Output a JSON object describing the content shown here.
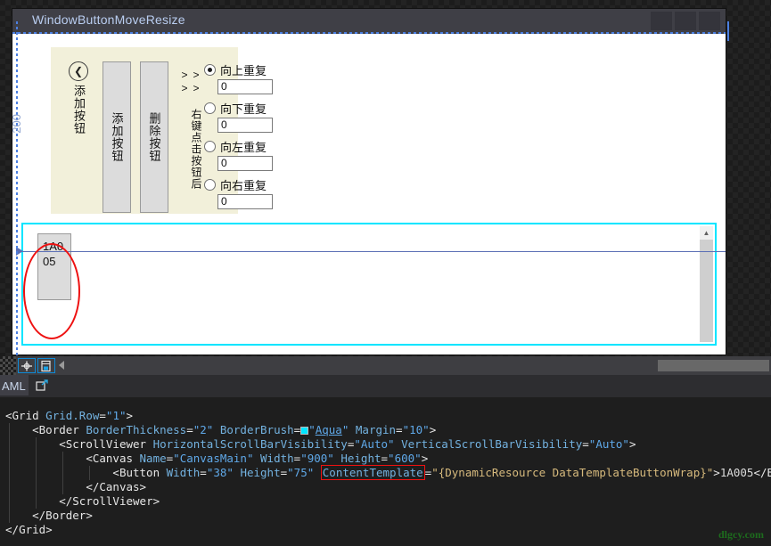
{
  "preview_window": {
    "title": "WindowButtonMoveResize",
    "window_buttons": [
      "minimize",
      "maximize",
      "close"
    ]
  },
  "ruler": {
    "label": "200"
  },
  "panel": {
    "back_button_icon": "chevron-left-icon",
    "back_label": "添加按钮",
    "buttons": [
      {
        "id": "add",
        "label": "添加按钮"
      },
      {
        "id": "delete",
        "label": "删除按钮"
      }
    ],
    "hint": ">> 右键点击按钮后 >>",
    "repeat_options": [
      {
        "label": "向上重复",
        "checked": true,
        "value": "0"
      },
      {
        "label": "向下重复",
        "checked": false,
        "value": "0"
      },
      {
        "label": "向左重复",
        "checked": false,
        "value": "0"
      },
      {
        "label": "向右重复",
        "checked": false,
        "value": "0"
      }
    ]
  },
  "canvas": {
    "button_text": "1A005",
    "scroll_up_icon": "chevron-up-icon",
    "border_color": "#00e5ff",
    "annotation_color": "#ee1111"
  },
  "toolbar": {
    "pan_icon": "pan-tool-icon",
    "snap_icon": "snap-to-grid-icon",
    "collapse_icon": "collapse-left-icon"
  },
  "tabs": {
    "xaml_label": "AML",
    "popout_icon": "pop-out-icon"
  },
  "code": {
    "lines": [
      {
        "indent": 0,
        "parts": [
          {
            "t": "<",
            "c": "pn"
          },
          {
            "t": "Grid",
            "c": "el"
          },
          {
            "t": " ",
            "c": "txt"
          },
          {
            "t": "Grid.Row",
            "c": "attr"
          },
          {
            "t": "=",
            "c": "pn"
          },
          {
            "t": "\"1\"",
            "c": "val"
          },
          {
            "t": ">",
            "c": "pn"
          }
        ]
      },
      {
        "indent": 1,
        "parts": [
          {
            "t": "<",
            "c": "pn"
          },
          {
            "t": "Border",
            "c": "el"
          },
          {
            "t": " ",
            "c": "txt"
          },
          {
            "t": "BorderThickness",
            "c": "attr"
          },
          {
            "t": "=",
            "c": "pn"
          },
          {
            "t": "\"2\"",
            "c": "val"
          },
          {
            "t": " ",
            "c": "txt"
          },
          {
            "t": "BorderBrush",
            "c": "attr"
          },
          {
            "t": "=",
            "c": "pn"
          },
          {
            "t": "SWATCH",
            "c": "swatch"
          },
          {
            "t": "\"",
            "c": "val"
          },
          {
            "t": "Aqua",
            "c": "link"
          },
          {
            "t": "\"",
            "c": "val"
          },
          {
            "t": " ",
            "c": "txt"
          },
          {
            "t": "Margin",
            "c": "attr"
          },
          {
            "t": "=",
            "c": "pn"
          },
          {
            "t": "\"10\"",
            "c": "val"
          },
          {
            "t": ">",
            "c": "pn"
          }
        ]
      },
      {
        "indent": 2,
        "parts": [
          {
            "t": "<",
            "c": "pn"
          },
          {
            "t": "ScrollViewer",
            "c": "el"
          },
          {
            "t": " ",
            "c": "txt"
          },
          {
            "t": "HorizontalScrollBarVisibility",
            "c": "attr"
          },
          {
            "t": "=",
            "c": "pn"
          },
          {
            "t": "\"Auto\"",
            "c": "val"
          },
          {
            "t": " ",
            "c": "txt"
          },
          {
            "t": "VerticalScrollBarVisibility",
            "c": "attr"
          },
          {
            "t": "=",
            "c": "pn"
          },
          {
            "t": "\"Auto\"",
            "c": "val"
          },
          {
            "t": ">",
            "c": "pn"
          }
        ]
      },
      {
        "indent": 3,
        "parts": [
          {
            "t": "<",
            "c": "pn"
          },
          {
            "t": "Canvas",
            "c": "el"
          },
          {
            "t": " ",
            "c": "txt"
          },
          {
            "t": "Name",
            "c": "attr"
          },
          {
            "t": "=",
            "c": "pn"
          },
          {
            "t": "\"CanvasMain\"",
            "c": "val"
          },
          {
            "t": " ",
            "c": "txt"
          },
          {
            "t": "Width",
            "c": "attr"
          },
          {
            "t": "=",
            "c": "pn"
          },
          {
            "t": "\"900\"",
            "c": "val"
          },
          {
            "t": " ",
            "c": "txt"
          },
          {
            "t": "Height",
            "c": "attr"
          },
          {
            "t": "=",
            "c": "pn"
          },
          {
            "t": "\"600\"",
            "c": "val"
          },
          {
            "t": ">",
            "c": "pn"
          }
        ]
      },
      {
        "indent": 4,
        "parts": [
          {
            "t": "<",
            "c": "pn"
          },
          {
            "t": "Button",
            "c": "el"
          },
          {
            "t": " ",
            "c": "txt"
          },
          {
            "t": "Width",
            "c": "attr"
          },
          {
            "t": "=",
            "c": "pn"
          },
          {
            "t": "\"38\"",
            "c": "val"
          },
          {
            "t": " ",
            "c": "txt"
          },
          {
            "t": "Height",
            "c": "attr"
          },
          {
            "t": "=",
            "c": "pn"
          },
          {
            "t": "\"75\"",
            "c": "val"
          },
          {
            "t": " ",
            "c": "txt"
          },
          {
            "t": "ContentTemplate",
            "c": "attr-boxed"
          },
          {
            "t": "=",
            "c": "pn"
          },
          {
            "t": "\"{DynamicResource ",
            "c": "res"
          },
          {
            "t": "DataTemplateButtonWrap}\"",
            "c": "res"
          },
          {
            "t": ">",
            "c": "pn"
          },
          {
            "t": "1A005",
            "c": "txt"
          },
          {
            "t": "</",
            "c": "pn"
          },
          {
            "t": "Button",
            "c": "el"
          },
          {
            "t": ">",
            "c": "pn"
          }
        ]
      },
      {
        "indent": 3,
        "parts": [
          {
            "t": "</",
            "c": "pn"
          },
          {
            "t": "Canvas",
            "c": "el"
          },
          {
            "t": ">",
            "c": "pn"
          }
        ]
      },
      {
        "indent": 2,
        "parts": [
          {
            "t": "</",
            "c": "pn"
          },
          {
            "t": "ScrollViewer",
            "c": "el"
          },
          {
            "t": ">",
            "c": "pn"
          }
        ]
      },
      {
        "indent": 1,
        "parts": [
          {
            "t": "</",
            "c": "pn"
          },
          {
            "t": "Border",
            "c": "el"
          },
          {
            "t": ">",
            "c": "pn"
          }
        ]
      },
      {
        "indent": 0,
        "parts": [
          {
            "t": "</",
            "c": "pn"
          },
          {
            "t": "Grid",
            "c": "el"
          },
          {
            "t": ">",
            "c": "pn"
          }
        ]
      }
    ]
  },
  "watermark": {
    "text": "dlgcy.com"
  }
}
